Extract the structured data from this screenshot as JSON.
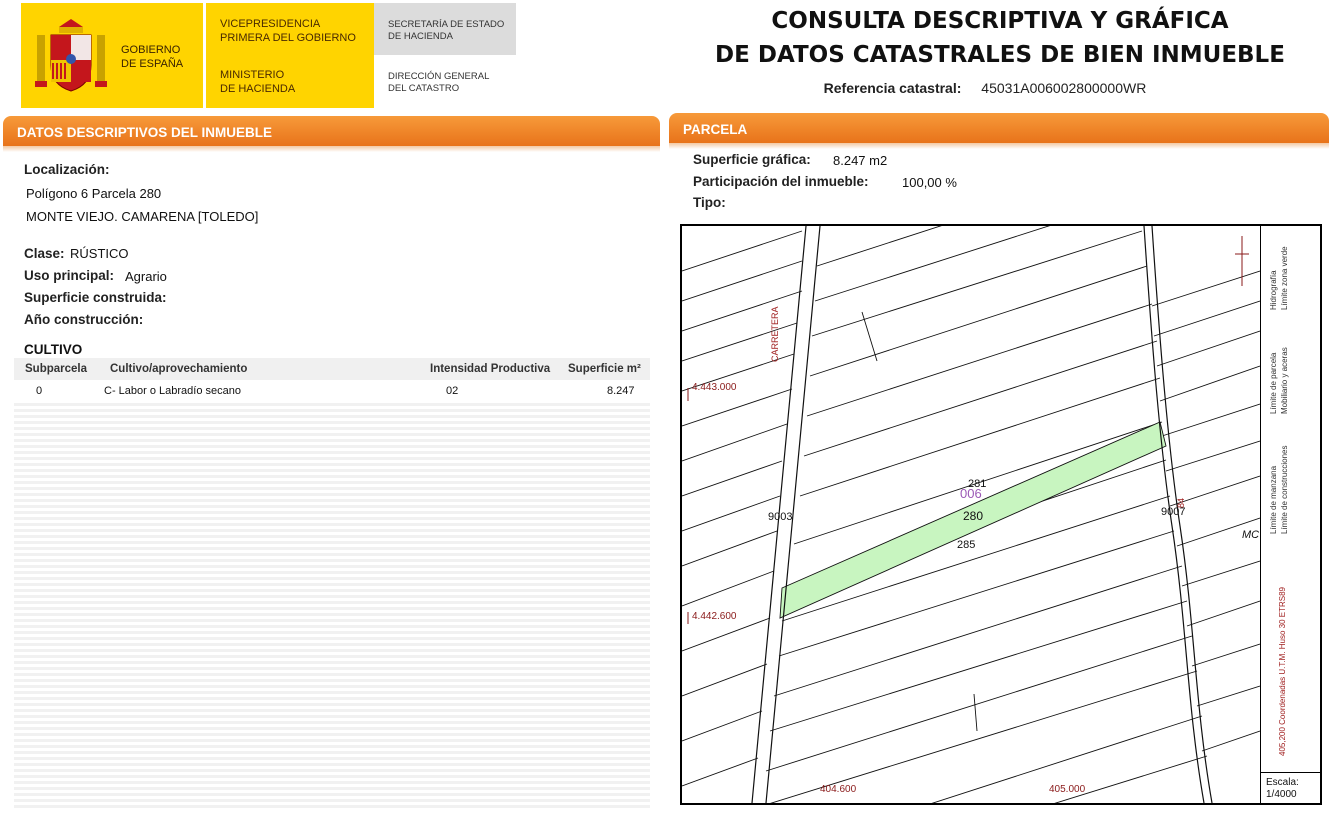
{
  "banner": {
    "gobierno": "GOBIERNO\nDE ESPAÑA",
    "vicepresidencia": "VICEPRESIDENCIA\nPRIMERA DEL GOBIERNO",
    "ministerio": "MINISTERIO\nDE HACIENDA",
    "secretaria": "SECRETARÍA DE ESTADO\nDE HACIENDA",
    "direccion": "DIRECCIÓN GENERAL\nDEL CATASTRO",
    "yellow": "#ffd400"
  },
  "title": {
    "line1": "CONSULTA DESCRIPTIVA Y GRÁFICA",
    "line2": "DE DATOS CATASTRALES DE BIEN INMUEBLE",
    "ref_label": "Referencia catastral:",
    "ref_value": "45031A006002800000WR"
  },
  "left": {
    "header": "DATOS DESCRIPTIVOS DEL INMUEBLE",
    "localizacion_label": "Localización:",
    "loc_line1": "Polígono 6 Parcela 280",
    "loc_line2": "MONTE VIEJO. CAMARENA [TOLEDO]",
    "clase_label": "Clase:",
    "clase_value": "RÚSTICO",
    "uso_label": "Uso principal:",
    "uso_value": "Agrario",
    "superficie_label": "Superficie construida:",
    "anio_label": "Año construcción:",
    "cultivo_title": "CULTIVO",
    "table_headers": [
      "Subparcela",
      "Cultivo/aprovechamiento",
      "Intensidad Productiva",
      "Superficie m²"
    ],
    "rows": [
      {
        "subparcela": "0",
        "cultivo": "C- Labor o Labradío secano",
        "intensidad": "02",
        "superficie": "8.247"
      }
    ]
  },
  "right": {
    "header": "PARCELA",
    "superficie_label": "Superficie gráfica:",
    "superficie_value": "8.247 m2",
    "participacion_label": "Participación del inmueble:",
    "participacion_value": "100,00 %",
    "tipo_label": "Tipo:"
  },
  "map": {
    "coords": {
      "y1": "4.443.000",
      "y2": "4.442.600",
      "x1": "404.600",
      "x2": "405.000"
    },
    "labels": {
      "carretera": "CARRETERA",
      "road_a": "9003",
      "road_b": "9007",
      "p281": "281",
      "p280": "280",
      "p285": "285",
      "poligono": "006",
      "mc": "MC",
      "r84": "84"
    },
    "highlight_color": "#c8f5c0",
    "legend_items": [
      "Hidrografía",
      "Límite zona verde",
      "Límite de parcela",
      "Mobiliario y aceras",
      "Límite de manzana",
      "Límite de construcciones"
    ],
    "legend_coords": "405,200 Coordenadas U.T.M. Huso 30 ETRS89",
    "escala_label": "Escala:",
    "escala_value": "1/4000"
  }
}
